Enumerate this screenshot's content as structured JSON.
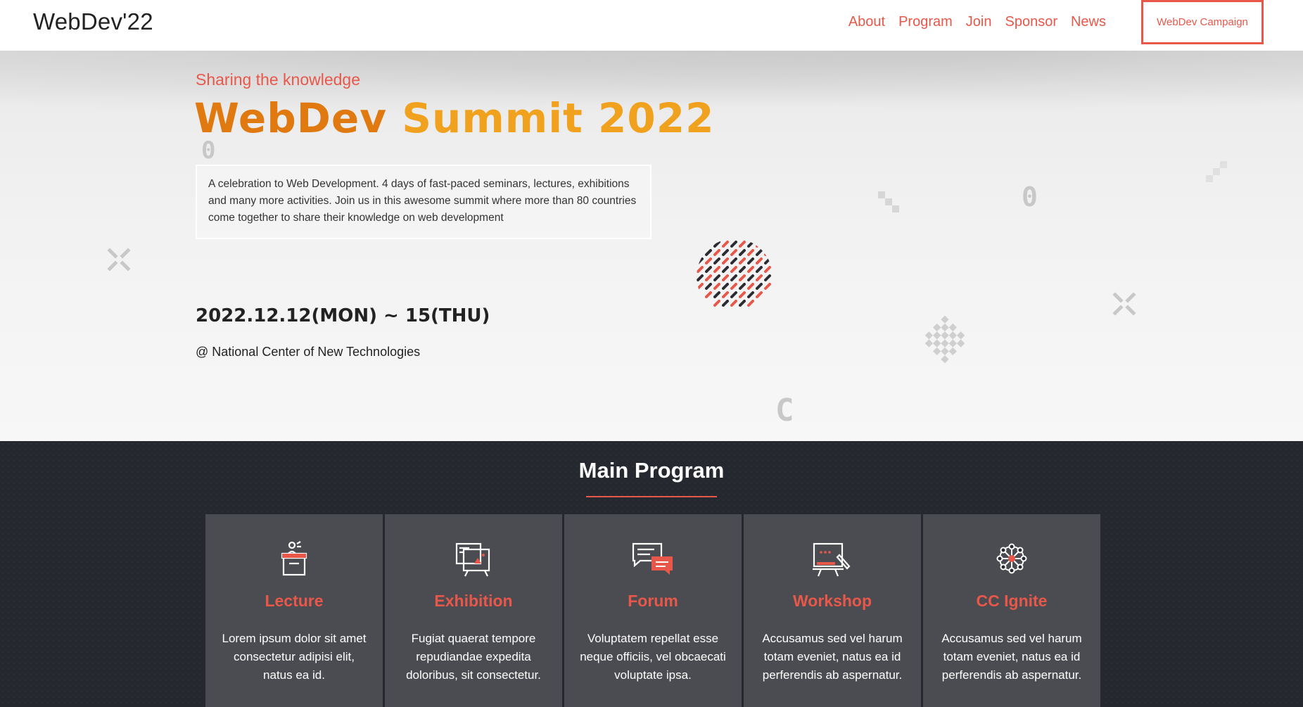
{
  "header": {
    "logo": "WebDev'22",
    "nav": [
      "About",
      "Program",
      "Join",
      "Sponsor",
      "News"
    ],
    "campaign_button": "WebDev Campaign"
  },
  "hero": {
    "tagline": "Sharing the knowledge",
    "title_part1": "WebDev",
    "title_part2": "Summit 2022",
    "description": "A celebration to Web Development. 4 days of fast-paced seminars, lectures, exhibitions and many more activities. Join us in this awesome summit where more than 80 countries come together to share their knowledge on web development",
    "date": "2022.12.12(MON) ~ 15(THU)",
    "venue": "@ National Center of New Technologies"
  },
  "program": {
    "title": "Main Program",
    "cards": [
      {
        "icon": "podium-icon",
        "title": "Lecture",
        "text": "Lorem ipsum dolor sit amet consectetur adipisi elit, natus ea id."
      },
      {
        "icon": "presentation-board-icon",
        "title": "Exhibition",
        "text": "Fugiat quaerat tempore repudiandae expedita doloribus, sit consectetur."
      },
      {
        "icon": "chat-bubbles-icon",
        "title": "Forum",
        "text": "Voluptatem repellat esse neque officiis, vel obcaecati voluptate ipsa."
      },
      {
        "icon": "whiteboard-icon",
        "title": "Workshop",
        "text": "Accusamus sed vel harum totam eveniet, natus ea id perferendis ab aspernatur."
      },
      {
        "icon": "network-icon",
        "title": "CC Ignite",
        "text": "Accusamus sed vel harum totam eveniet, natus ea id perferendis ab aspernatur."
      }
    ]
  },
  "colors": {
    "accent": "#e8584a",
    "title_orange": "#e07a10",
    "title_yellow": "#f0a21e",
    "dark_bg": "#262830",
    "card_bg": "#4b4c51"
  }
}
